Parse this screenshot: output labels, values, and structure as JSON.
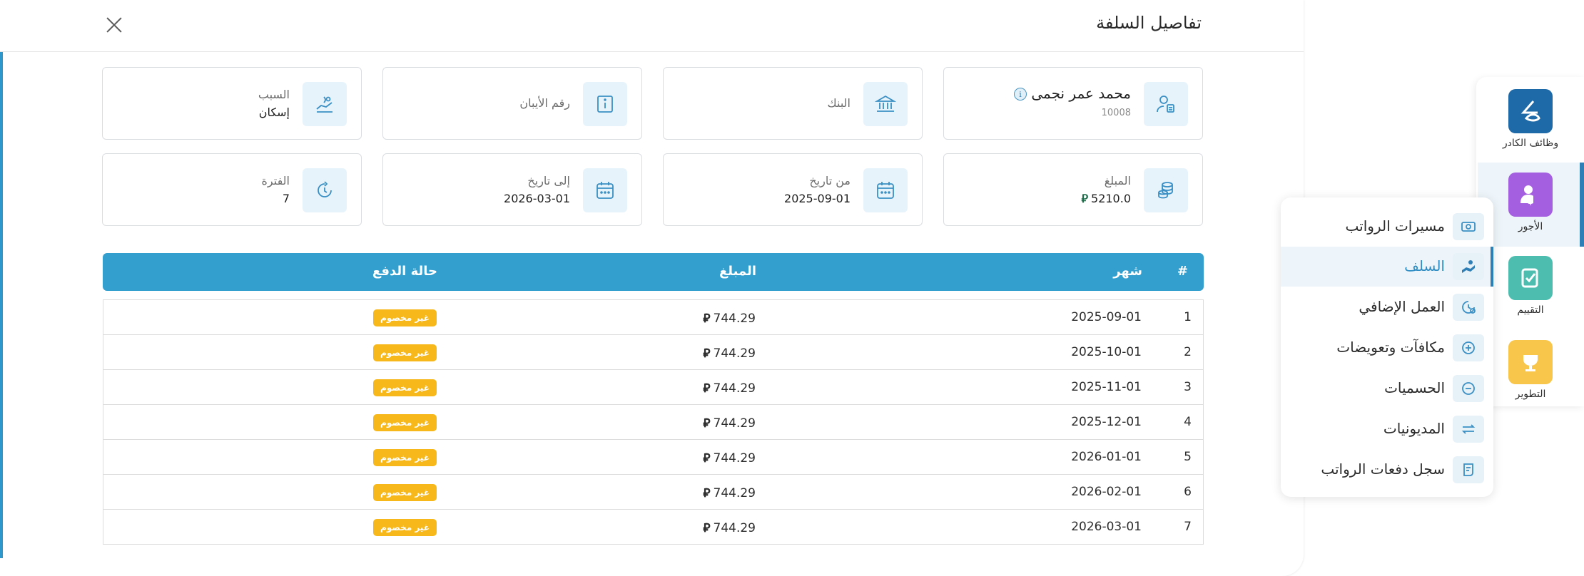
{
  "modal": {
    "title": "تفاصيل السلفة",
    "close_label": "×"
  },
  "info_cards": {
    "employee_name": "محمد عمر نجمى",
    "employee_id": "10008",
    "bank_label": "البنك",
    "iban_label": "رقم الأيبان",
    "reason_label": "السبب",
    "reason_value": "إسكان",
    "amount_label": "المبلغ",
    "amount_value": "5210.0",
    "from_label": "من تاريخ",
    "from_value": "2025-09-01",
    "to_label": "إلى تاريخ",
    "to_value": "2026-03-01",
    "period_label": "الفترة",
    "period_value": "7"
  },
  "currency_symbol": "⃁",
  "table": {
    "headers": {
      "num": "#",
      "month": "شهر",
      "amount": "المبلغ",
      "status": "حالة الدفع"
    },
    "rows": [
      {
        "num": "1",
        "month": "2025-09-01",
        "amount": "744.29",
        "status": "غير مخصوم"
      },
      {
        "num": "2",
        "month": "2025-10-01",
        "amount": "744.29",
        "status": "غير مخصوم"
      },
      {
        "num": "3",
        "month": "2025-11-01",
        "amount": "744.29",
        "status": "غير مخصوم"
      },
      {
        "num": "4",
        "month": "2025-12-01",
        "amount": "744.29",
        "status": "غير مخصوم"
      },
      {
        "num": "5",
        "month": "2026-01-01",
        "amount": "744.29",
        "status": "غير مخصوم"
      },
      {
        "num": "6",
        "month": "2026-02-01",
        "amount": "744.29",
        "status": "غير مخصوم"
      },
      {
        "num": "7",
        "month": "2026-03-01",
        "amount": "744.29",
        "status": "غير مخصوم"
      }
    ]
  },
  "rail": {
    "items": [
      {
        "label": "وظائف الكادر",
        "icon": "staff-functions-icon",
        "color": "#1e6aa8"
      },
      {
        "label": "الأجور",
        "icon": "wages-icon",
        "color": "#a45ee0"
      },
      {
        "label": "التقييم",
        "icon": "evaluation-icon",
        "color": "#4dbdb0"
      },
      {
        "label": "التطوير",
        "icon": "development-icon",
        "color": "#f7c64a"
      }
    ]
  },
  "submenu": {
    "items": [
      {
        "label": "مسيرات الرواتب",
        "icon": "payroll-icon"
      },
      {
        "label": "السلف",
        "icon": "advance-icon"
      },
      {
        "label": "العمل الإضافي",
        "icon": "overtime-icon"
      },
      {
        "label": "مكافآت وتعويضات",
        "icon": "bonus-icon"
      },
      {
        "label": "الحسميات",
        "icon": "deductions-icon"
      },
      {
        "label": "المديونيات",
        "icon": "debts-icon"
      },
      {
        "label": "سجل دفعات الرواتب",
        "icon": "salary-payments-log-icon"
      }
    ]
  },
  "colors": {
    "accent": "#2e98cc",
    "badge": "#f6b81a",
    "icon_stroke": "#3a8fc4"
  }
}
